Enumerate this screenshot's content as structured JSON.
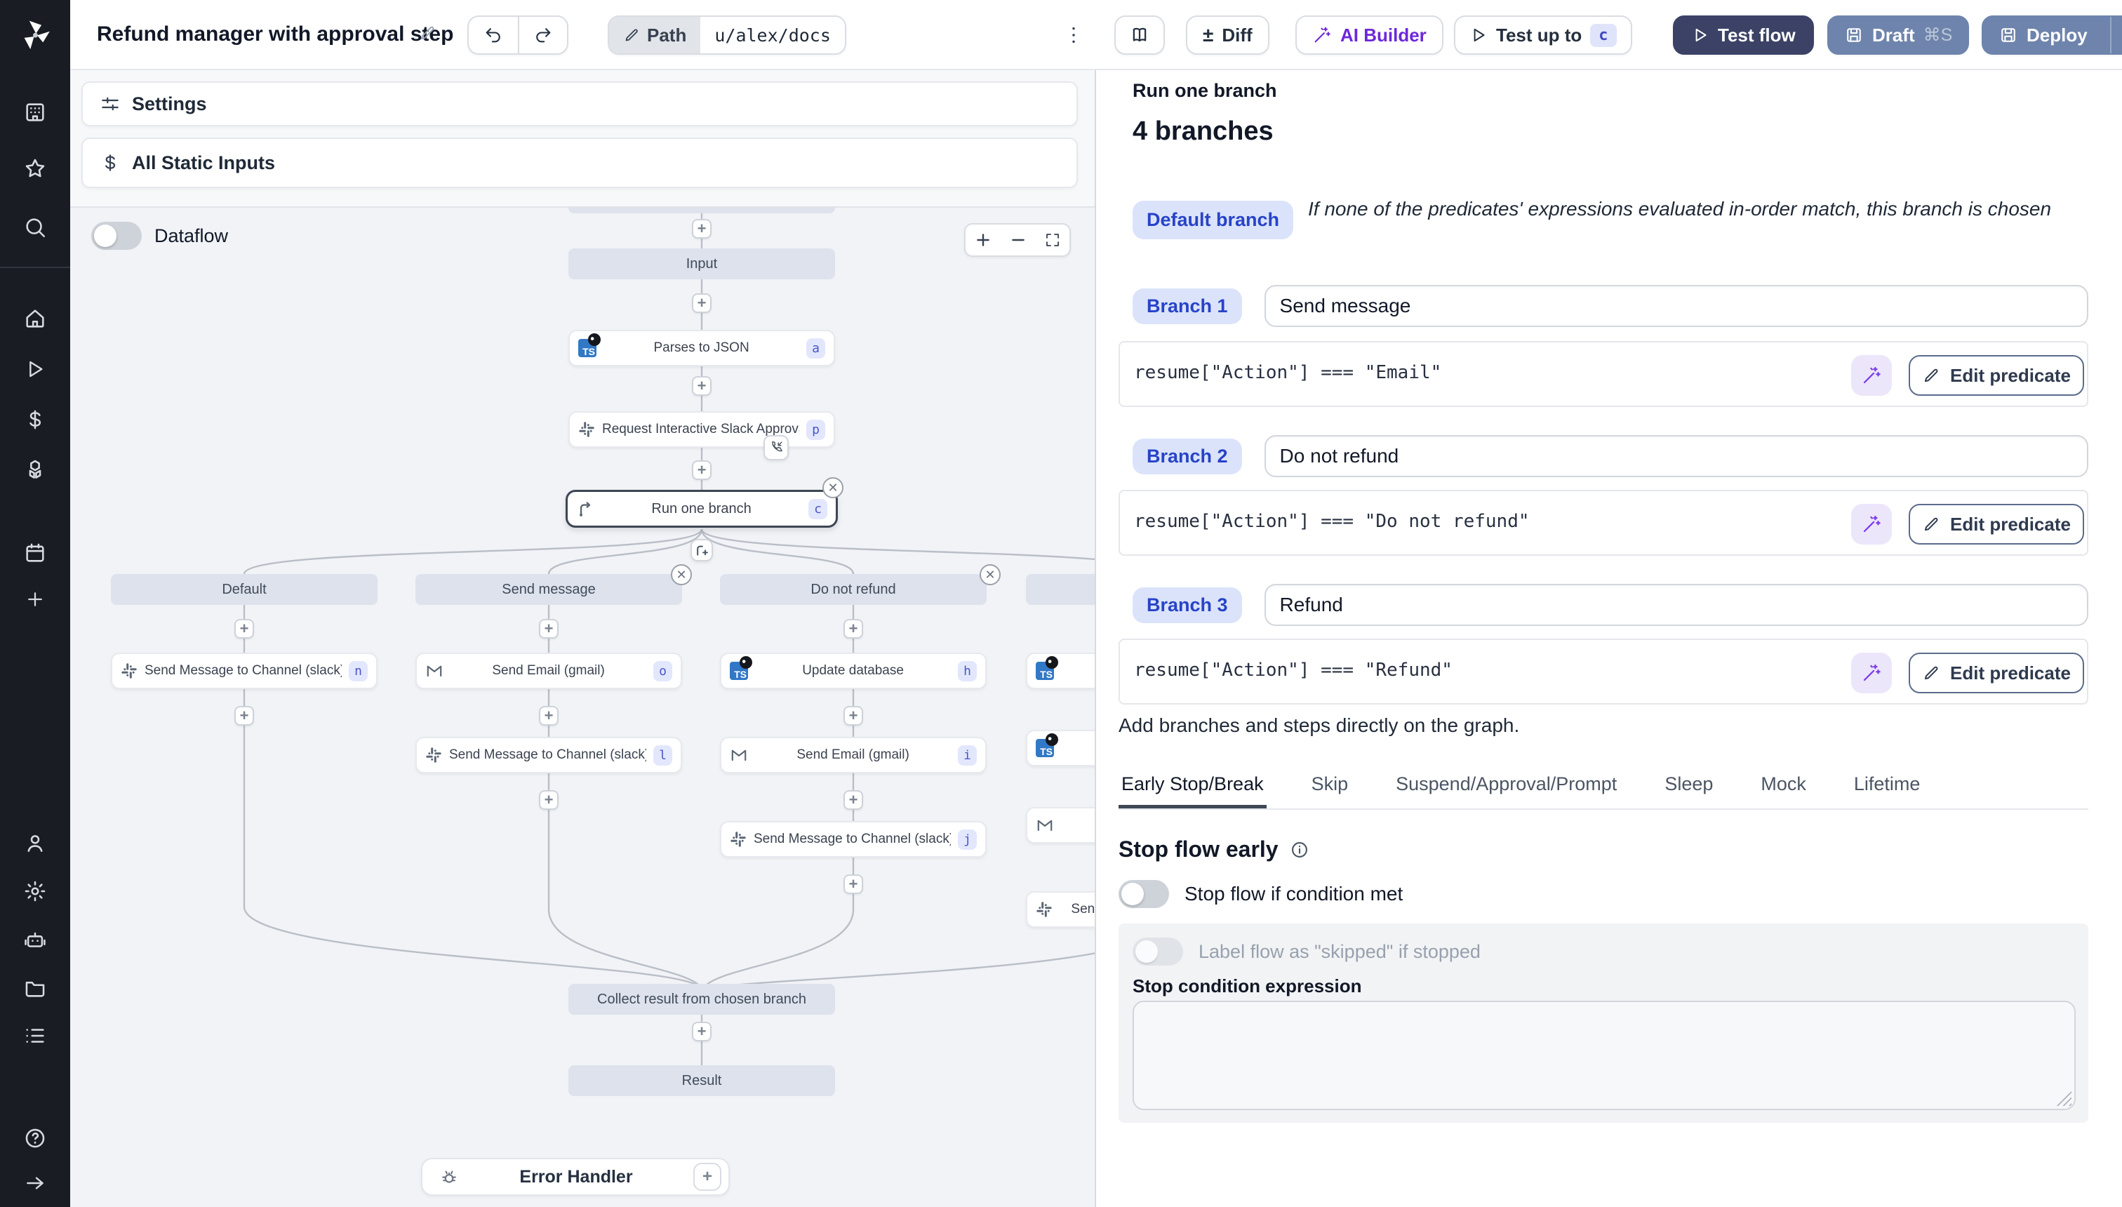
{
  "topbar": {
    "title": "Refund manager with approval step",
    "path_label": "Path",
    "path_value": "u/alex/docs",
    "diff_label": "Diff",
    "ai_builder_label": "AI Builder",
    "test_up_to_label": "Test up to",
    "test_up_to_badge": "c",
    "test_flow_label": "Test flow",
    "draft_label": "Draft",
    "draft_shortcut": "⌘S",
    "deploy_label": "Deploy"
  },
  "sidebar": {
    "icons": [
      "windmill-logo",
      "workspace-icon",
      "favorites-star-icon",
      "search-icon",
      "home-icon",
      "runs-play-icon",
      "variables-dollar-icon",
      "resources-cubes-icon",
      "schedules-calendar-icon",
      "add-plus-icon",
      "user-icon",
      "settings-gear-icon",
      "workers-robot-icon",
      "folders-icon",
      "audit-list-icon",
      "help-icon",
      "expand-arrow-icon"
    ]
  },
  "left_panel": {
    "settings_label": "Settings",
    "static_inputs_label": "All Static Inputs",
    "dataflow_label": "Dataflow"
  },
  "graph": {
    "input_label": "Input",
    "parse_step": {
      "label": "Parses to JSON",
      "badge": "a",
      "icon": "typescript-icon"
    },
    "approval_step": {
      "label": "Request Interactive Slack Approval (...",
      "badge": "p",
      "icon": "slack-icon"
    },
    "run_branch_step": {
      "label": "Run one branch",
      "badge": "c",
      "icon": "branch-split-icon"
    },
    "columns": [
      {
        "header": "Default",
        "steps": [
          {
            "label": "Send Message to Channel (slack)",
            "badge": "n",
            "icon": "slack-icon"
          }
        ]
      },
      {
        "header": "Send message",
        "steps": [
          {
            "label": "Send Email (gmail)",
            "badge": "o",
            "icon": "gmail-icon"
          },
          {
            "label": "Send Message to Channel (slack)",
            "badge": "l",
            "icon": "slack-icon"
          }
        ]
      },
      {
        "header": "Do not refund",
        "steps": [
          {
            "label": "Update database",
            "badge": "h",
            "icon": "typescript-icon"
          },
          {
            "label": "Send Email (gmail)",
            "badge": "i",
            "icon": "gmail-icon"
          },
          {
            "label": "Send Message to Channel (slack)",
            "badge": "j",
            "icon": "slack-icon"
          }
        ]
      },
      {
        "header": "",
        "steps": [
          {
            "label": "",
            "badge": "",
            "icon": "typescript-icon"
          },
          {
            "label": "",
            "badge": "",
            "icon": "typescript-icon"
          },
          {
            "label": "",
            "badge": "",
            "icon": "gmail-icon"
          },
          {
            "label": "Send Message to Channel (slack)",
            "badge": "",
            "icon": "slack-icon"
          }
        ]
      }
    ],
    "collect_label": "Collect result from chosen branch",
    "result_label": "Result",
    "error_handler_label": "Error Handler"
  },
  "right_panel": {
    "title": "Run one branch",
    "subtitle": "4 branches",
    "default_branch": {
      "badge": "Default branch",
      "description": "If none of the predicates' expressions evaluated in-order match, this branch is chosen"
    },
    "branches": [
      {
        "badge": "Branch 1",
        "name": "Send message",
        "predicate": "resume[\"Action\"] === \"Email\"",
        "edit_label": "Edit predicate"
      },
      {
        "badge": "Branch 2",
        "name": "Do not refund",
        "predicate": "resume[\"Action\"] === \"Do not refund\"",
        "edit_label": "Edit predicate"
      },
      {
        "badge": "Branch 3",
        "name": "Refund",
        "predicate": "resume[\"Action\"] === \"Refund\"",
        "edit_label": "Edit predicate"
      }
    ],
    "add_note": "Add branches and steps directly on the graph.",
    "tabs": [
      "Early Stop/Break",
      "Skip",
      "Suspend/Approval/Prompt",
      "Sleep",
      "Mock",
      "Lifetime"
    ],
    "active_tab": "Early Stop/Break",
    "early_stop": {
      "title": "Stop flow early",
      "stop_toggle_label": "Stop flow if condition met",
      "skipped_toggle_label": "Label flow as \"skipped\" if stopped",
      "expression_label": "Stop condition expression"
    }
  },
  "colors": {
    "accent_blue": "#2743c8",
    "badge_bg": "#dbe3fa",
    "dark_button": "#3b4266",
    "slate_button": "#6e84ac",
    "ai_purple": "#6d28d9",
    "canvas_bg": "#f1f3f6"
  }
}
